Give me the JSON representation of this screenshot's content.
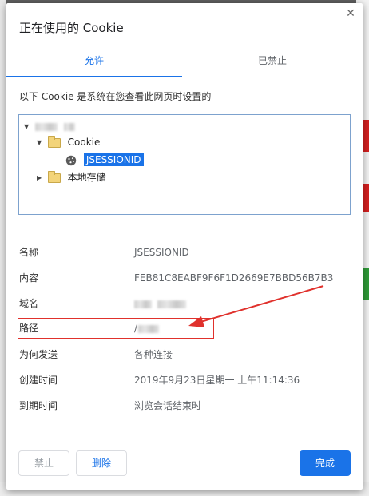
{
  "dialog": {
    "title": "正在使用的 Cookie",
    "close_glyph": "✕"
  },
  "tabs": [
    {
      "label": "允许",
      "active": true
    },
    {
      "label": "已禁止",
      "active": false
    }
  ],
  "description": "以下 Cookie 是系统在您查看此网页时设置的",
  "tree": {
    "site_node_blurred": true,
    "cookie_folder_label": "Cookie",
    "selected_cookie": "JSESSIONID",
    "local_storage_label": "本地存储"
  },
  "details": [
    {
      "label": "名称",
      "value": "JSESSIONID"
    },
    {
      "label": "内容",
      "value": "FEB81C8EABF9F6F1D2669E7BBD56B7B3"
    },
    {
      "label": "域名",
      "value": ""
    },
    {
      "label": "路径",
      "value": "/"
    },
    {
      "label": "为何发送",
      "value": "各种连接"
    },
    {
      "label": "创建时间",
      "value": "2019年9月23日星期一 上午11:14:36"
    },
    {
      "label": "到期时间",
      "value": "浏览会话结束时"
    }
  ],
  "buttons": {
    "block": "禁止",
    "remove": "删除",
    "done": "完成"
  },
  "colors": {
    "accent": "#1a73e8",
    "annotation_red": "#e0312c"
  }
}
